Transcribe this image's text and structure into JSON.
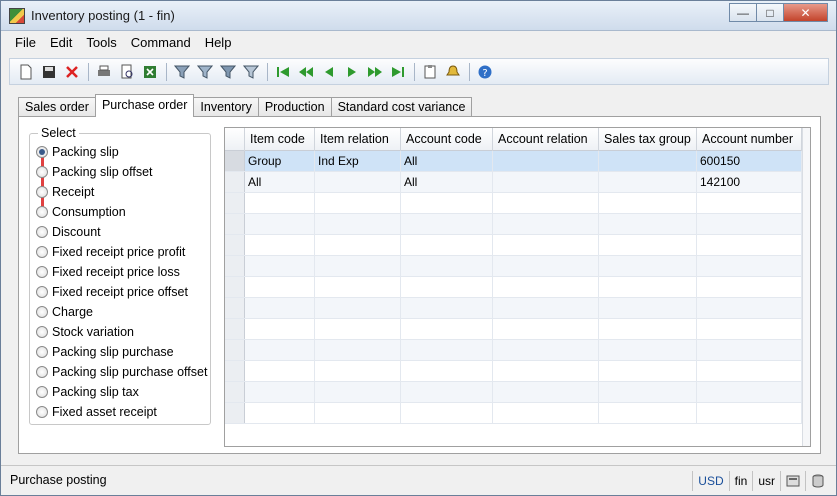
{
  "window": {
    "title": "Inventory posting (1 - fin)",
    "controls": [
      "minimize",
      "maximize",
      "close"
    ]
  },
  "menu": [
    "File",
    "Edit",
    "Tools",
    "Command",
    "Help"
  ],
  "toolbar_icons": [
    "new-icon",
    "save-icon",
    "delete-icon",
    "print-icon",
    "print-preview-icon",
    "export-excel-icon",
    "filter-by-selection-icon",
    "filter-by-grid-icon",
    "advanced-filter-icon",
    "remove-filter-icon",
    "first-record-icon",
    "previous-page-icon",
    "previous-record-icon",
    "next-record-icon",
    "next-page-icon",
    "last-record-icon",
    "document-handling-icon",
    "alert-icon",
    "help-icon"
  ],
  "tabs": [
    {
      "label": "Sales order",
      "active": false
    },
    {
      "label": "Purchase order",
      "active": true
    },
    {
      "label": "Inventory",
      "active": false
    },
    {
      "label": "Production",
      "active": false
    },
    {
      "label": "Standard cost variance",
      "active": false
    }
  ],
  "select_group": {
    "legend": "Select",
    "selected_index": 0,
    "options": [
      "Packing slip",
      "Packing slip offset",
      "Receipt",
      "Consumption",
      "Discount",
      "Fixed receipt price profit",
      "Fixed receipt price loss",
      "Fixed receipt price offset",
      "Charge",
      "Stock variation",
      "Packing slip purchase",
      "Packing slip purchase offset",
      "Packing slip tax",
      "Fixed asset receipt"
    ]
  },
  "grid": {
    "columns": [
      "Item code",
      "Item relation",
      "Account code",
      "Account relation",
      "Sales tax group",
      "Account number"
    ],
    "rows": [
      [
        "Group",
        "Ind Exp",
        "All",
        "",
        "",
        "600150"
      ],
      [
        "All",
        "",
        "All",
        "",
        "",
        "142100"
      ]
    ],
    "selected_row": 0,
    "empty_rows": 11
  },
  "status": {
    "text": "Purchase posting",
    "currency": "USD",
    "company": "fin",
    "layer": "usr",
    "icons": [
      "session-icon",
      "database-icon"
    ]
  },
  "colors": {
    "selection": "#cfe3f7",
    "required_marker": "#e04040",
    "nav_green": "#2e9a2e"
  }
}
